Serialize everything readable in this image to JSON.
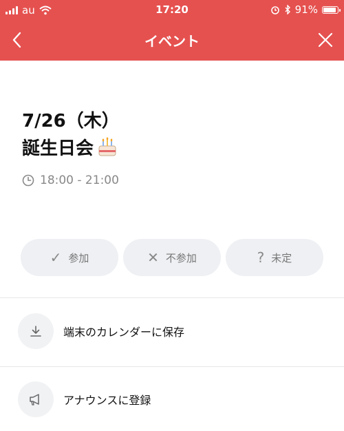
{
  "status_bar": {
    "carrier": "au",
    "time": "17:20",
    "battery_percent": "91%"
  },
  "header": {
    "title": "イベント"
  },
  "event": {
    "date": "7/26（木）",
    "title": "誕生日会",
    "time_range": "18:00 - 21:00"
  },
  "rsvp": {
    "join_label": "参加",
    "decline_label": "不参加",
    "undecided_label": "未定"
  },
  "actions": {
    "save_calendar_label": "端末のカレンダーに保存",
    "announce_label": "アナウンスに登録"
  },
  "colors": {
    "header_bg": "#e5514f",
    "button_bg": "#eef0f3"
  }
}
